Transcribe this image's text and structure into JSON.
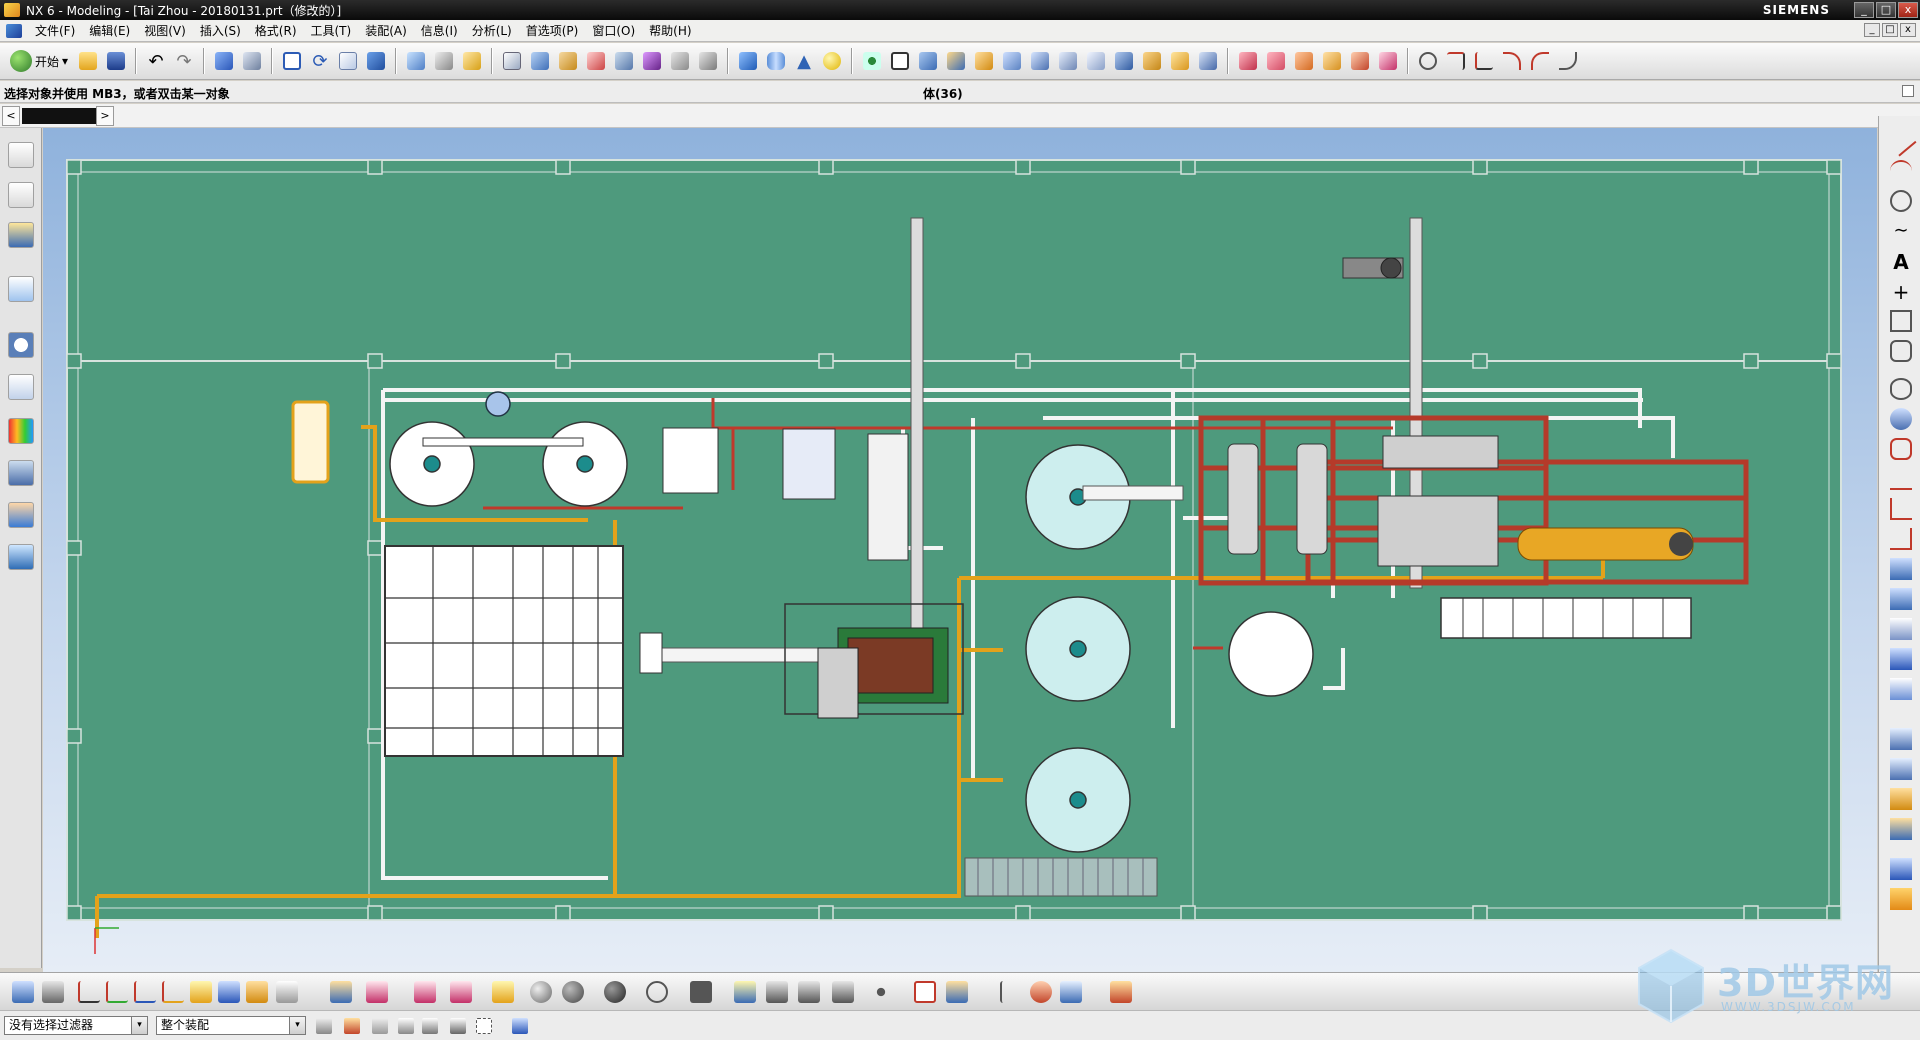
{
  "window": {
    "title": "NX 6 - Modeling - [Tai Zhou - 20180131.prt（修改的）]",
    "brand": "SIEMENS",
    "controls": [
      "_",
      "□",
      "x"
    ]
  },
  "menu": {
    "items": [
      "文件(F)",
      "编辑(E)",
      "视图(V)",
      "插入(S)",
      "格式(R)",
      "工具(T)",
      "装配(A)",
      "信息(I)",
      "分析(L)",
      "首选项(P)",
      "窗口(O)",
      "帮助(H)"
    ]
  },
  "toolbar": {
    "start_label": "开始",
    "start_arrow": "▾"
  },
  "cue_line": {
    "prompt": "选择对象并使用 MB3，或者双击某一对象",
    "status": "体(36)"
  },
  "nav": {
    "left_arrow": "<",
    "right_arrow": ">"
  },
  "selection_bar": {
    "filter_value": "没有选择过滤器",
    "scope_value": "整个装配",
    "drop_glyph": "▾"
  },
  "watermark": {
    "text": "3D世界网",
    "url": "WWW.3DSJW.COM"
  },
  "colors": {
    "floor": "#4e9a7d",
    "grid_line": "#d7e3de",
    "pipe_yellow": "#e3a21b",
    "pipe_red": "#c0392b",
    "frame_red": "#b53a2a",
    "tank_fill": "#ffffff",
    "tank_teal": "#cdeeee"
  }
}
